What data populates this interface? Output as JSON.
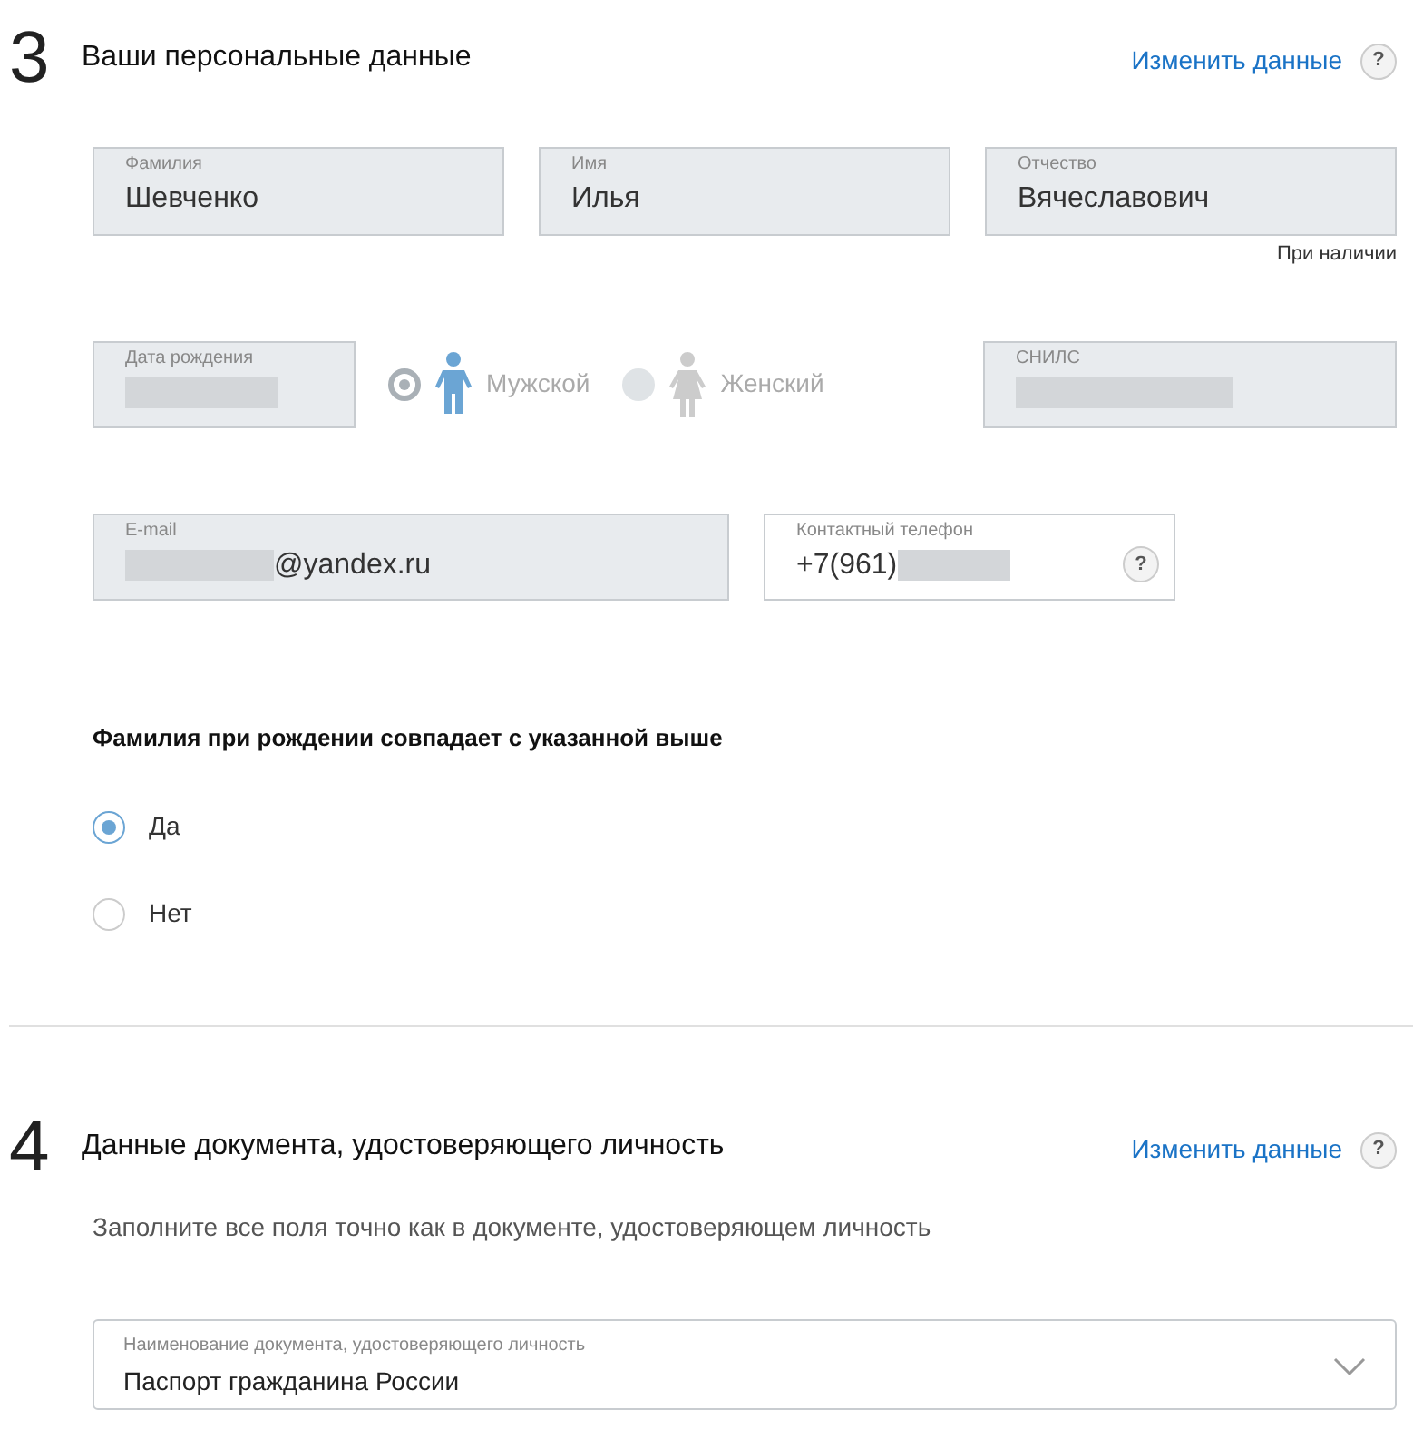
{
  "section_3": {
    "number": "3",
    "title": "Ваши персональные данные",
    "edit_link": "Изменить данные",
    "help": "?",
    "name_fields": [
      {
        "label": "Фамилия",
        "value": "Шевченко",
        "disabled": true
      },
      {
        "label": "Имя",
        "value": "Илья",
        "disabled": true
      },
      {
        "label": "Отчество",
        "value": "Вячеславович",
        "disabled": true
      }
    ],
    "patronymic_note": "При наличии",
    "birth_date": {
      "label": "Дата рождения",
      "masked_before": true,
      "disabled": true
    },
    "gender": [
      {
        "label": "Мужской",
        "kind": "male",
        "selected": true
      },
      {
        "label": "Женский",
        "kind": "female",
        "selected": false
      }
    ],
    "snils": {
      "label": "СНИЛС",
      "masked_before": true,
      "disabled": true
    },
    "email": {
      "label": "E-mail",
      "value": "@yandex.ru",
      "masked_before": true,
      "disabled": true
    },
    "phone": {
      "label": "Контактный телефон",
      "value": "+7(961)",
      "masked_after": true,
      "disabled": false,
      "help": "?"
    },
    "maiden_question": "Фамилия при рождении совпадает с указанной выше",
    "maiden_options": [
      {
        "label": "Да",
        "selected": true
      },
      {
        "label": "Нет",
        "selected": false
      }
    ]
  },
  "section_4": {
    "number": "4",
    "title": "Данные документа, удостоверяющего личность",
    "edit_link": "Изменить данные",
    "help": "?",
    "hint": "Заполните все поля точно как в документе, удостоверяющем личность",
    "document_select": {
      "label": "Наименование документа, удостоверяющего личность",
      "value": "Паспорт гражданина России"
    }
  }
}
